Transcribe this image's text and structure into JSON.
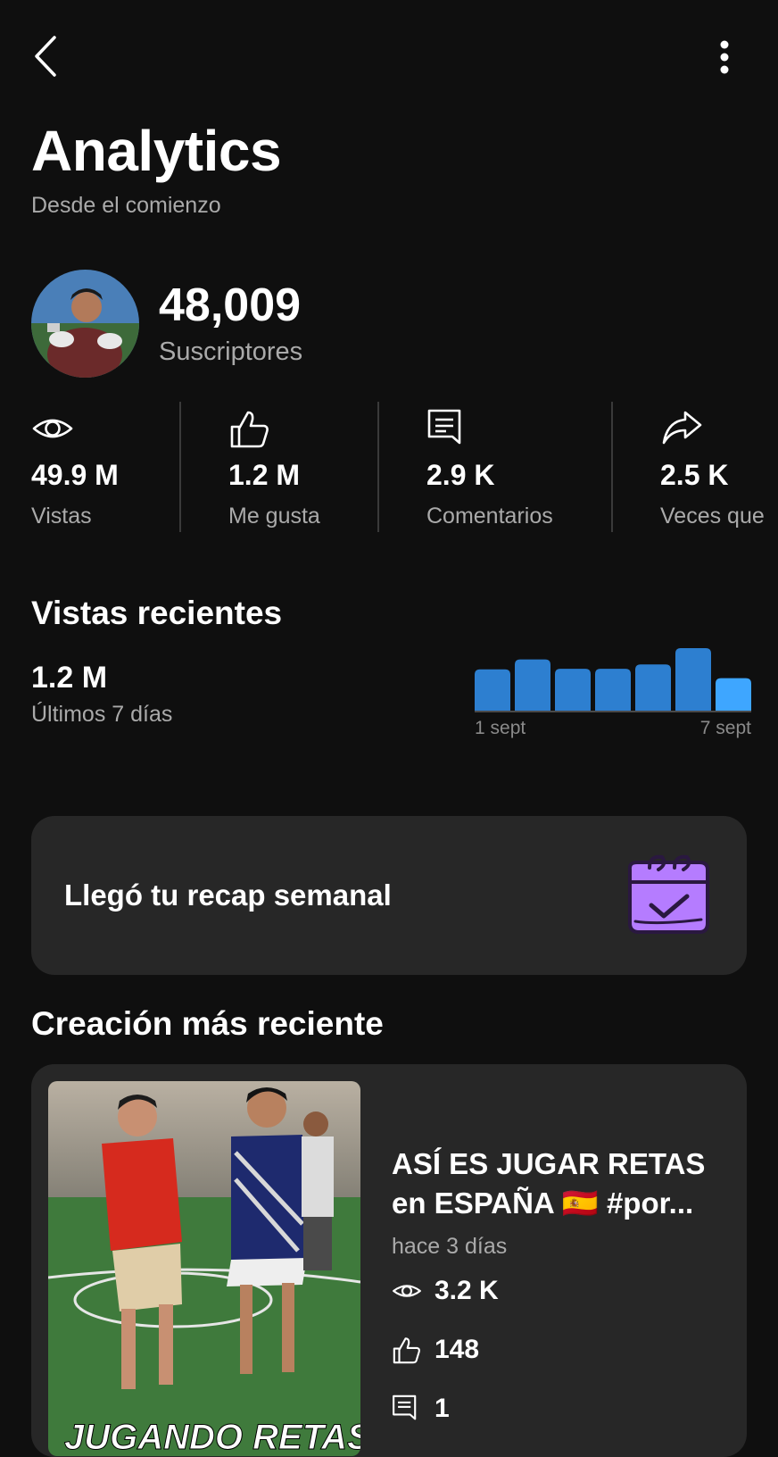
{
  "header": {
    "title": "Analytics",
    "subtitle": "Desde el comienzo"
  },
  "channel": {
    "subscribers": "48,009",
    "subscribers_label": "Suscriptores"
  },
  "stats": [
    {
      "icon": "eye-icon",
      "value": "49.9 M",
      "label": "Vistas"
    },
    {
      "icon": "thumbs-up-icon",
      "value": "1.2 M",
      "label": "Me gusta"
    },
    {
      "icon": "comment-icon",
      "value": "2.9 K",
      "label": "Comentarios"
    },
    {
      "icon": "share-icon",
      "value": "2.5 K",
      "label": "Veces que"
    }
  ],
  "recent_views": {
    "title": "Vistas recientes",
    "value": "1.2 M",
    "period": "Últimos 7 días"
  },
  "chart_data": {
    "type": "bar",
    "categories": [
      "1 sept",
      "2 sept",
      "3 sept",
      "4 sept",
      "5 sept",
      "6 sept",
      "7 sept"
    ],
    "tick_labels": [
      "1 sept",
      "7 sept"
    ],
    "values": [
      0.66,
      0.82,
      0.67,
      0.67,
      0.74,
      1.0,
      0.52
    ],
    "ylim": [
      0,
      1
    ],
    "colors": {
      "past": "#2d7fd0",
      "current": "#3ea6ff",
      "baseline": "#4a4a4a"
    },
    "grid": false,
    "legend": "none"
  },
  "recap": {
    "text": "Llegó tu recap semanal",
    "icon": "calendar-check-icon",
    "accent": "#b57cff"
  },
  "latest": {
    "title": "Creación más reciente",
    "video_title": "ASÍ ES JUGAR RETAS en ESPAÑA 🇪🇸 #por...",
    "date": "hace 3 días",
    "views": "3.2 K",
    "likes": "148",
    "comments": "1",
    "thumb_caption": "JUGANDO RETAS EN"
  }
}
